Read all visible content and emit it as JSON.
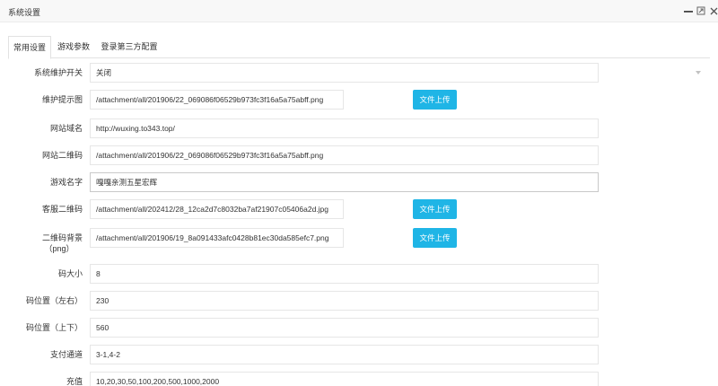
{
  "window": {
    "title": "系统设置",
    "controls": [
      "minimize-icon",
      "maximize-icon",
      "close-icon"
    ]
  },
  "tabs": [
    {
      "label": "常用设置",
      "active": true
    },
    {
      "label": "游戏参数",
      "active": false
    },
    {
      "label": "登录第三方配置",
      "active": false
    }
  ],
  "form": {
    "maintenance": {
      "label": "系统维护开关",
      "value": "关闭"
    },
    "maintenance_image": {
      "label": "维护提示图",
      "value": "/attachment/all/201906/22_069086f06529b973fc3f16a5a75abff.png",
      "button": "文件上传"
    },
    "domain": {
      "label": "网站域名",
      "value": "http://wuxing.to343.top/"
    },
    "site_qrcode": {
      "label": "网站二维码",
      "value": "/attachment/all/201906/22_069086f06529b973fc3f16a5a75abff.png"
    },
    "game_name": {
      "label": "游戏名字",
      "value": "嘎嘎亲测五星宏辉"
    },
    "service_qrcode": {
      "label": "客服二维码",
      "value": "/attachment/all/202412/28_12ca2d7c8032ba7af21907c05406a2d.jpg",
      "button": "文件上传"
    },
    "qrcode_bg": {
      "label_line1": "二维码背景",
      "label_line2": "（png）",
      "value": "/attachment/all/201906/19_8a091433afc0428b81ec30da585efc7.png",
      "button": "文件上传"
    },
    "code_size": {
      "label": "码大小",
      "value": "8"
    },
    "code_pos_x": {
      "label": "码位置（左右）",
      "value": "230"
    },
    "code_pos_y": {
      "label": "码位置（上下）",
      "value": "560"
    },
    "pay_channel": {
      "label": "支付通道",
      "value": "3-1,4-2"
    },
    "recharge": {
      "label": "充值",
      "value": "10,20,30,50,100,200,500,1000,2000"
    }
  }
}
